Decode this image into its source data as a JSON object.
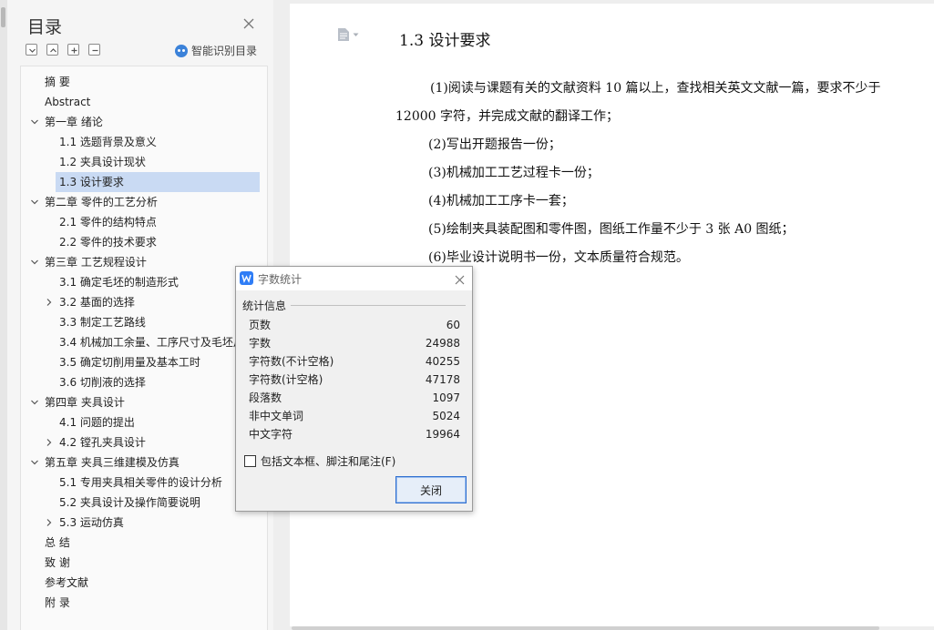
{
  "nav": {
    "title": "目录",
    "smart_toc_label": "智能识别目录",
    "tools": [
      "collapse-all",
      "expand-level",
      "add-item",
      "remove-item"
    ],
    "toc": [
      {
        "label": "摘  要",
        "level": 1,
        "chevron": "none",
        "selected": false
      },
      {
        "label": "Abstract",
        "level": 1,
        "chevron": "none",
        "selected": false
      },
      {
        "label": "第一章  绪论",
        "level": 1,
        "chevron": "down",
        "selected": false
      },
      {
        "label": "1.1 选题背景及意义",
        "level": 2,
        "chevron": "none",
        "selected": false
      },
      {
        "label": "1.2 夹具设计现状",
        "level": 2,
        "chevron": "none",
        "selected": false
      },
      {
        "label": "1.3 设计要求",
        "level": 2,
        "chevron": "none",
        "selected": true
      },
      {
        "label": "第二章  零件的工艺分析",
        "level": 1,
        "chevron": "down",
        "selected": false
      },
      {
        "label": "2.1 零件的结构特点",
        "level": 2,
        "chevron": "none",
        "selected": false
      },
      {
        "label": "2.2  零件的技术要求",
        "level": 2,
        "chevron": "none",
        "selected": false
      },
      {
        "label": "第三章  工艺规程设计",
        "level": 1,
        "chevron": "down",
        "selected": false
      },
      {
        "label": "3.1  确定毛坯的制造形式",
        "level": 2,
        "chevron": "none",
        "selected": false
      },
      {
        "label": "3.2 基面的选择",
        "level": 2,
        "chevron": "right",
        "selected": false
      },
      {
        "label": "3.3  制定工艺路线",
        "level": 2,
        "chevron": "none",
        "selected": false
      },
      {
        "label": "3.4  机械加工余量、工序尺寸及毛坯尺寸的确定",
        "level": 2,
        "chevron": "none",
        "selected": false
      },
      {
        "label": "3.5 确定切削用量及基本工时",
        "level": 2,
        "chevron": "none",
        "selected": false
      },
      {
        "label": "3.6  切削液的选择",
        "level": 2,
        "chevron": "none",
        "selected": false
      },
      {
        "label": "第四章  夹具设计",
        "level": 1,
        "chevron": "down",
        "selected": false
      },
      {
        "label": "4.1  问题的提出",
        "level": 2,
        "chevron": "none",
        "selected": false
      },
      {
        "label": "4.2  镗孔夹具设计",
        "level": 2,
        "chevron": "right",
        "selected": false
      },
      {
        "label": "第五章  夹具三维建模及仿真",
        "level": 1,
        "chevron": "down",
        "selected": false
      },
      {
        "label": "5.1 专用夹具相关零件的设计分析",
        "level": 2,
        "chevron": "none",
        "selected": false
      },
      {
        "label": "5.2 夹具设计及操作简要说明",
        "level": 2,
        "chevron": "none",
        "selected": false
      },
      {
        "label": "5.3 运动仿真",
        "level": 2,
        "chevron": "right",
        "selected": false
      },
      {
        "label": "总  结",
        "level": 1,
        "chevron": "none",
        "selected": false
      },
      {
        "label": "致  谢",
        "level": 1,
        "chevron": "none",
        "selected": false
      },
      {
        "label": "参考文献",
        "level": 1,
        "chevron": "none",
        "selected": false
      },
      {
        "label": "附  录",
        "level": 1,
        "chevron": "none",
        "selected": false
      }
    ]
  },
  "document": {
    "heading": "1.3 设计要求",
    "paragraphs": [
      "(1)阅读与课题有关的文献资料 10 篇以上，查找相关英文文献一篇，要求不少于 12000 字符，并完成文献的翻译工作；",
      "(2)写出开题报告一份；",
      "(3)机械加工工艺过程卡一份；",
      "(4)机械加工工序卡一套；",
      "(5)绘制夹具装配图和零件图，图纸工作量不少于 3 张 A0 图纸；",
      "(6)毕业设计说明书一份，文本质量符合规范。"
    ]
  },
  "dialog": {
    "title": "字数统计",
    "group_label": "统计信息",
    "stats": [
      {
        "label": "页数",
        "value": "60"
      },
      {
        "label": "字数",
        "value": "24988"
      },
      {
        "label": "字符数(不计空格)",
        "value": "40255"
      },
      {
        "label": "字符数(计空格)",
        "value": "47178"
      },
      {
        "label": "段落数",
        "value": "1097"
      },
      {
        "label": "非中文单词",
        "value": "5024"
      },
      {
        "label": "中文字符",
        "value": "19964"
      }
    ],
    "checkbox_label": "包括文本框、脚注和尾注(F)",
    "checkbox_checked": false,
    "close_label": "关闭"
  },
  "colors": {
    "selection": "#c9daf3",
    "accent": "#2f7df6",
    "button_border": "#2f6fd0"
  }
}
